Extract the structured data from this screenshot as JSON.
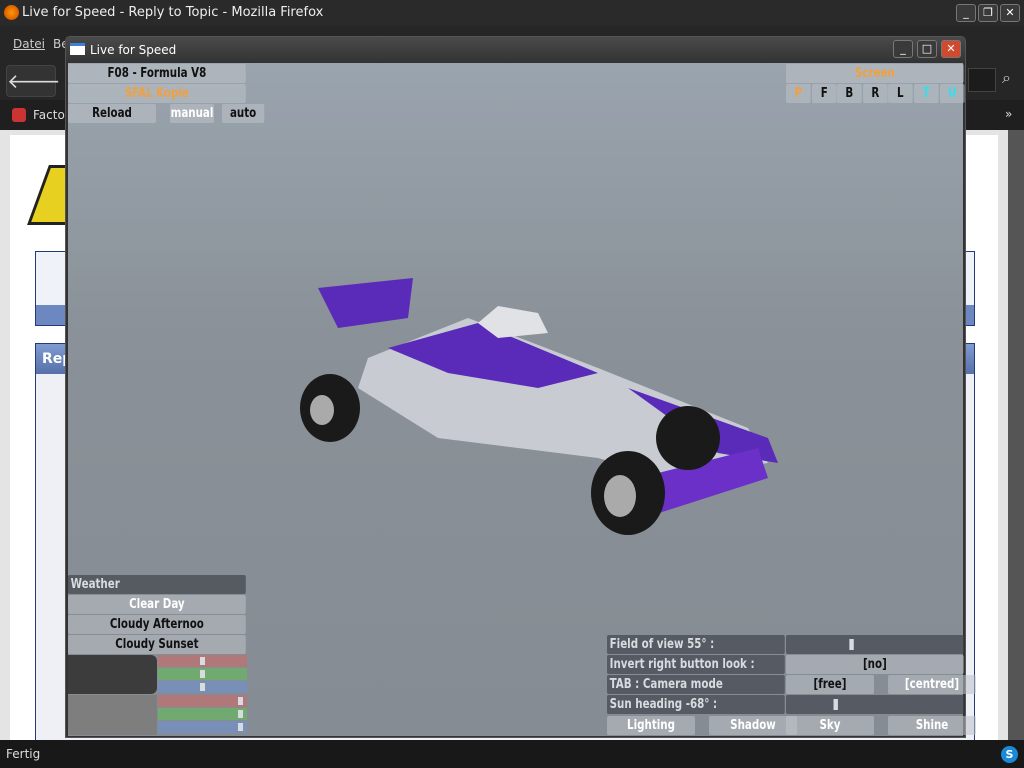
{
  "browser": {
    "title": "Live for Speed - Reply to Topic - Mozilla Firefox",
    "menu": [
      "Datei",
      "Be"
    ],
    "bookmark": "Factory",
    "status": "Fertig",
    "page_tab": "Rep"
  },
  "lfs": {
    "window_title": "Live for Speed",
    "car": {
      "name": "F08 - Formula V8",
      "skin": "SFAL Kopie",
      "reload": "Reload",
      "manual": "manual",
      "auto": "auto"
    },
    "screen": {
      "title": "Screen",
      "buttons": [
        "P",
        "F",
        "B",
        "R",
        "L",
        "T",
        "U"
      ]
    },
    "weather": {
      "title": "Weather",
      "options": [
        "Clear Day",
        "Cloudy Afternoo",
        "Cloudy Sunset"
      ],
      "selected": "Clear Day",
      "slider1": [
        0.5,
        0.5,
        0.5
      ],
      "slider2": [
        0.95,
        0.95,
        0.95
      ]
    },
    "camera": {
      "fov_label": "Field of view 55° :",
      "fov_value": 0.4,
      "invert_label": "Invert right button look :",
      "invert_value": "[no]",
      "tab_label": "TAB : Camera mode",
      "tab_free": "[free]",
      "tab_centred": "[centred]",
      "sun_label": "Sun heading -68° :",
      "sun_value": 0.3,
      "tabs": [
        "Lighting",
        "Shadow",
        "Sky",
        "Shine"
      ]
    },
    "colors": {
      "accent": "#f0a040",
      "cyan": "#30e0f0",
      "car_purple": "#5a2ab8",
      "car_silver": "#c8ccd2"
    }
  }
}
